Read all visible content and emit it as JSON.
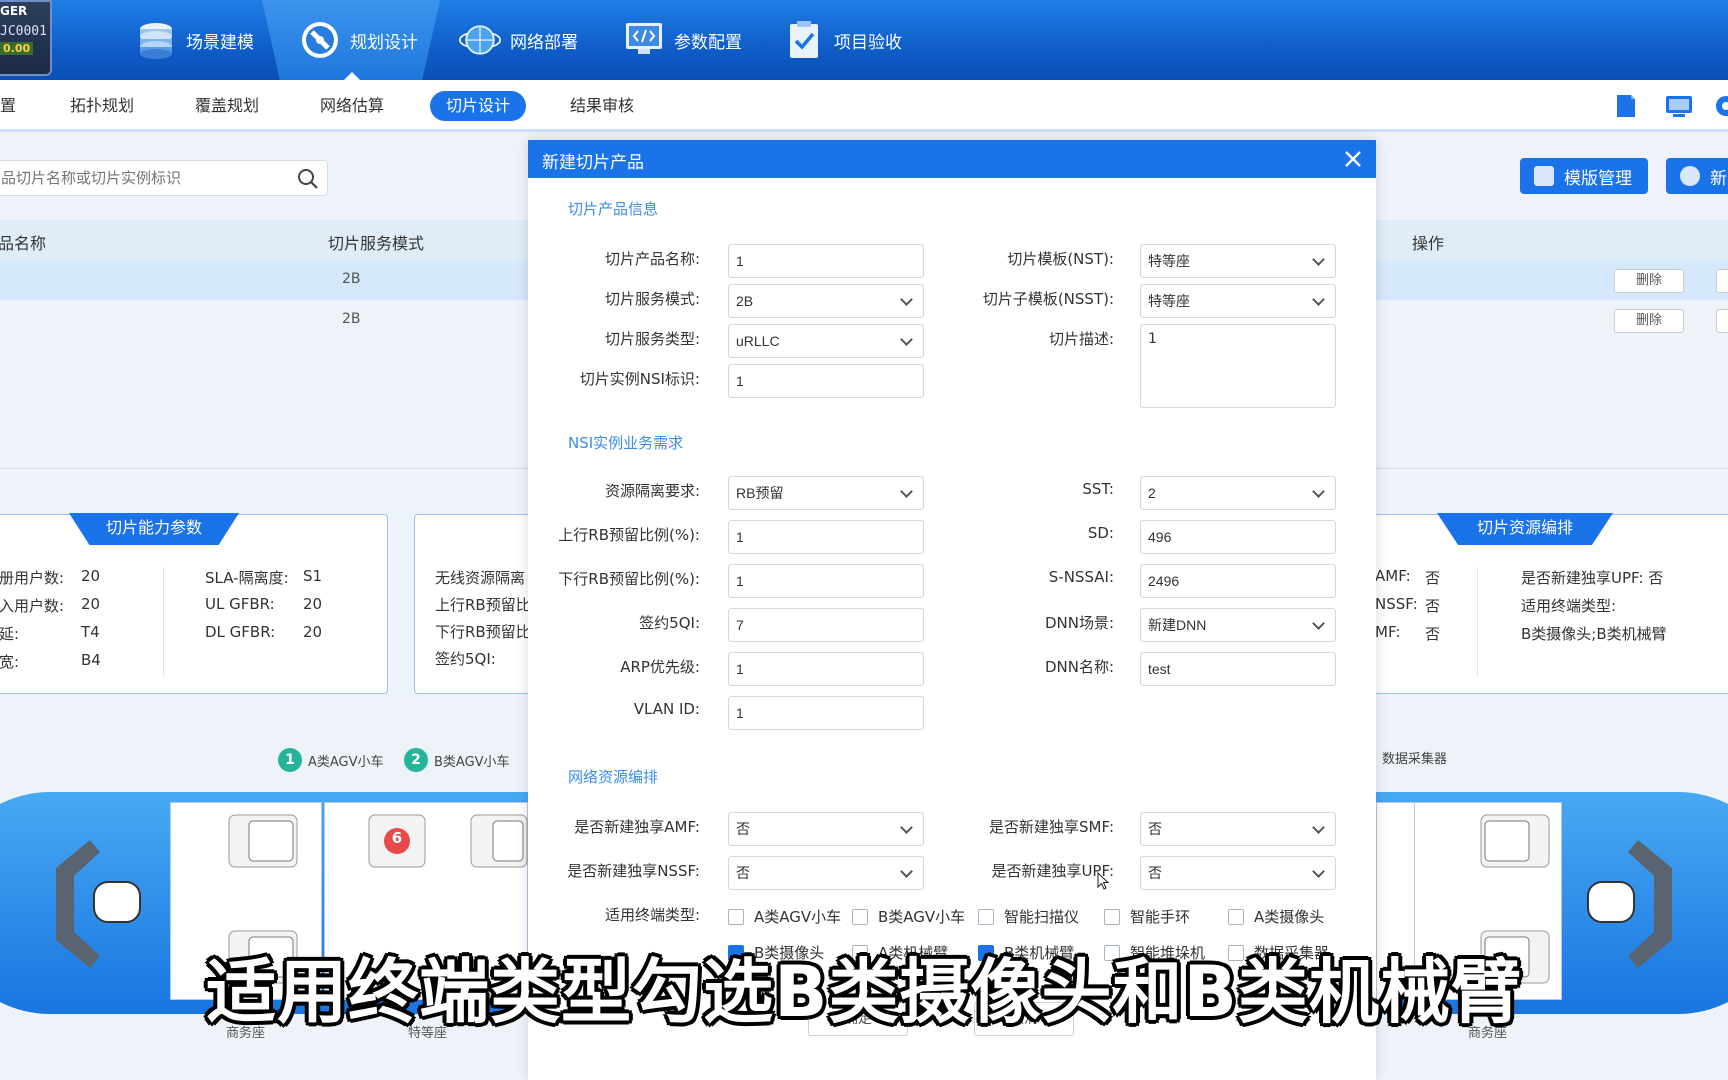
{
  "app": {
    "logo_top": "GER",
    "logo_code": "JC0001",
    "logo_value": "0.00"
  },
  "top_tabs": [
    {
      "label": "场景建模",
      "icon": "database-stack-icon"
    },
    {
      "label": "规划设计",
      "icon": "compass-icon",
      "active": true
    },
    {
      "label": "网络部署",
      "icon": "globe-icon"
    },
    {
      "label": "参数配置",
      "icon": "code-monitor-icon"
    },
    {
      "label": "项目验收",
      "icon": "clipboard-check-icon"
    }
  ],
  "sub_nav": {
    "items": [
      "置",
      "拓扑规划",
      "覆盖规划",
      "网络估算",
      "切片设计",
      "结果审核"
    ],
    "active": "切片设计"
  },
  "page": {
    "search_placeholder": "品切片名称或切片实例标识",
    "template_btn": "模版管理",
    "new_btn": "新",
    "columns": {
      "name": "品名称",
      "mode": "切片服务模式",
      "ops": "操作"
    },
    "rows": [
      {
        "mode": "2B",
        "delete": "删除",
        "selected": true
      },
      {
        "mode": "2B",
        "delete": "删除",
        "selected": false
      }
    ]
  },
  "capability_panel": {
    "title": "切片能力参数",
    "left": [
      {
        "k": "册用户数:",
        "v": "20"
      },
      {
        "k": "入用户数:",
        "v": "20"
      },
      {
        "k": "延:",
        "v": "T4"
      },
      {
        "k": "宽:",
        "v": "B4"
      }
    ],
    "right": [
      {
        "k": "SLA-隔离度:",
        "v": "S1"
      },
      {
        "k": "UL GFBR:",
        "v": "20"
      },
      {
        "k": "DL GFBR:",
        "v": "20"
      }
    ]
  },
  "mid_panel": {
    "lines": [
      "无线资源隔离",
      "上行RB预留比",
      "下行RB预留比",
      "签约5QI:"
    ]
  },
  "resource_panel": {
    "title": "切片资源编排",
    "left": [
      {
        "k": "AMF:",
        "v": "否"
      },
      {
        "k": "NSSF:",
        "v": "否"
      },
      {
        "k": "MF:",
        "v": "否"
      }
    ],
    "right": [
      "是否新建独享UPF:  否",
      "适用终端类型:",
      "B类摄像头;B类机械臂"
    ]
  },
  "train": {
    "legend": [
      {
        "num": "1",
        "label": "A类AGV小车"
      },
      {
        "num": "2",
        "label": "B类AGV小车"
      }
    ],
    "legend_right": "数据采集器",
    "badge": "6",
    "cars": [
      "商务座",
      "特等座",
      "商务座"
    ]
  },
  "modal": {
    "title": "新建切片产品",
    "sections": {
      "product_info": "切片产品信息",
      "nsi": "NSI实例业务需求",
      "network": "网络资源编排"
    },
    "fields": {
      "product_name": {
        "label": "切片产品名称:",
        "value": "1"
      },
      "service_mode": {
        "label": "切片服务模式:",
        "value": "2B"
      },
      "service_type": {
        "label": "切片服务类型:",
        "value": "uRLLC"
      },
      "nsi_id": {
        "label": "切片实例NSI标识:",
        "value": "1"
      },
      "nst": {
        "label": "切片模板(NST):",
        "value": "特等座"
      },
      "nsst": {
        "label": "切片子模板(NSST):",
        "value": "特等座"
      },
      "desc": {
        "label": "切片描述:",
        "value": "1"
      },
      "isolation": {
        "label": "资源隔离要求:",
        "value": "RB预留"
      },
      "ul_rb": {
        "label": "上行RB预留比例(%):",
        "value": "1"
      },
      "dl_rb": {
        "label": "下行RB预留比例(%):",
        "value": "1"
      },
      "qi": {
        "label": "签约5QI:",
        "value": "7"
      },
      "arp": {
        "label": "ARP优先级:",
        "value": "1"
      },
      "vlan": {
        "label": "VLAN ID:",
        "value": "1"
      },
      "sst": {
        "label": "SST:",
        "value": "2"
      },
      "sd": {
        "label": "SD:",
        "value": "496"
      },
      "snssai": {
        "label": "S-NSSAI:",
        "value": "2496"
      },
      "dnn_scene": {
        "label": "DNN场景:",
        "value": "新建DNN"
      },
      "dnn_name": {
        "label": "DNN名称:",
        "value": "test"
      },
      "amf": {
        "label": "是否新建独享AMF:",
        "value": "否"
      },
      "nssf": {
        "label": "是否新建独享NSSF:",
        "value": "否"
      },
      "smf": {
        "label": "是否新建独享SMF:",
        "value": "否"
      },
      "upf": {
        "label": "是否新建独享UPF:",
        "value": "否"
      }
    },
    "terminal_label": "适用终端类型:",
    "terminals_row1": [
      {
        "label": "A类AGV小车",
        "checked": false
      },
      {
        "label": "B类AGV小车",
        "checked": false
      },
      {
        "label": "智能扫描仪",
        "checked": false
      },
      {
        "label": "智能手环",
        "checked": false
      },
      {
        "label": "A类摄像头",
        "checked": false
      }
    ],
    "terminals_row2": [
      {
        "label": "B类摄像头",
        "checked": true
      },
      {
        "label": "A类机械臂",
        "checked": false
      },
      {
        "label": "B类机械臂",
        "checked": true
      },
      {
        "label": "智能堆垛机",
        "checked": false
      },
      {
        "label": "数据采集器",
        "checked": false
      }
    ],
    "ok": "确定",
    "cancel": "取消"
  },
  "subtitle": "适用终端类型勾选B类摄像头和B类机械臂"
}
